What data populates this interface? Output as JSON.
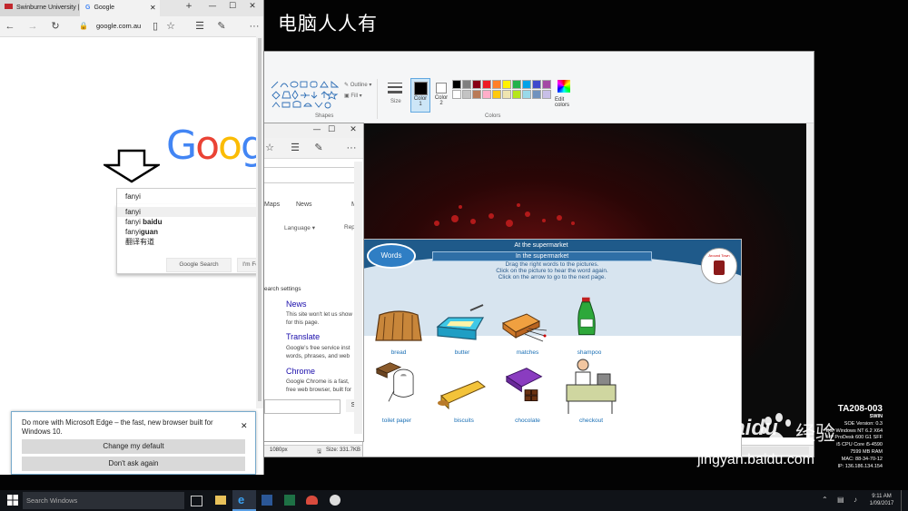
{
  "desktop": {
    "title": "电脑人人有"
  },
  "paint": {
    "shapes_label": "Shapes",
    "colors_label": "Colors",
    "outline_label": "Outline",
    "fill_label": "Fill",
    "size_label": "Size",
    "color1_label": "Color 1",
    "color2_label": "Color 2",
    "edit_colors_label": "Edit colors",
    "status_dims": "1080px",
    "status_size": "Size: 331.7KB",
    "palette": [
      "#000000",
      "#7f7f7f",
      "#880015",
      "#ed1c24",
      "#ff7f27",
      "#fff200",
      "#22b14c",
      "#00a2e8",
      "#3f48cc",
      "#a349a4",
      "#ffffff",
      "#c3c3c3",
      "#b97a57",
      "#ffaec9",
      "#ffc90e",
      "#efe4b0",
      "#b5e61d",
      "#99d9ea",
      "#7092be",
      "#c8bfe7"
    ]
  },
  "game": {
    "words_button": "Words",
    "title": "At the supermarket",
    "subtitle": "In the supermarket",
    "instructions": [
      "Drag the right words to the pictures.",
      "Click on the picture to hear the word again.",
      "Click on the arrow to go to the next page."
    ],
    "logo_text": "Around Town",
    "items": [
      "bread",
      "butter",
      "matches",
      "shampoo",
      "toilet paper",
      "biscuits",
      "chocolate",
      "checkout"
    ]
  },
  "edge2": {
    "nav_maps": "Maps",
    "nav_news": "News",
    "nav_m": "M",
    "language": "Language",
    "repl": "Repl",
    "search_settings": "earch settings",
    "news_title": "News",
    "news_body": "This site won't let us show for this page.",
    "translate_title": "Translate",
    "translate_body": "Google's free service inst words, phrases, and web",
    "chrome_title": "Chrome",
    "chrome_body": "Google Chrome is a fast, free web browser, built for",
    "search_btn": "S"
  },
  "edge": {
    "tabs": [
      "Swinburne University |",
      "Google"
    ],
    "address": "google.com.au",
    "logo_partial": "Goog",
    "search_value": "fanyi",
    "suggestions": [
      {
        "prefix": "fanyi",
        "suffix": ""
      },
      {
        "prefix": "fanyi ",
        "suffix": "baidu"
      },
      {
        "prefix": "fanyi",
        "suffix": "guan"
      },
      {
        "prefix": "翻译有道",
        "suffix": ""
      }
    ],
    "google_search_btn": "Google Search",
    "lucky_btn": "I'm Fe",
    "notification": {
      "message": "Do more with Microsoft Edge – the fast, new browser built for Windows 10.",
      "change_default": "Change my default",
      "dont_ask": "Don't ask again"
    }
  },
  "sysinfo": {
    "host": "TA208-003",
    "domain": "SWIN",
    "lines": [
      "SOE Version: 0.3",
      "OS: Windows NT 6.2 X64",
      "HP ProDesk 600 G1 SFF",
      "i5 CPU Core i5-4590",
      "7599 MB RAM",
      "MAC: 88-34-70-12",
      "IP: 136.186.134.154"
    ]
  },
  "watermark": {
    "brand": "Baidu",
    "cn": "经验",
    "url": "jingyan.baidu.com"
  },
  "taskbar": {
    "search_placeholder": "Search Windows",
    "time": "9:11 AM",
    "date": "1/09/2017"
  }
}
